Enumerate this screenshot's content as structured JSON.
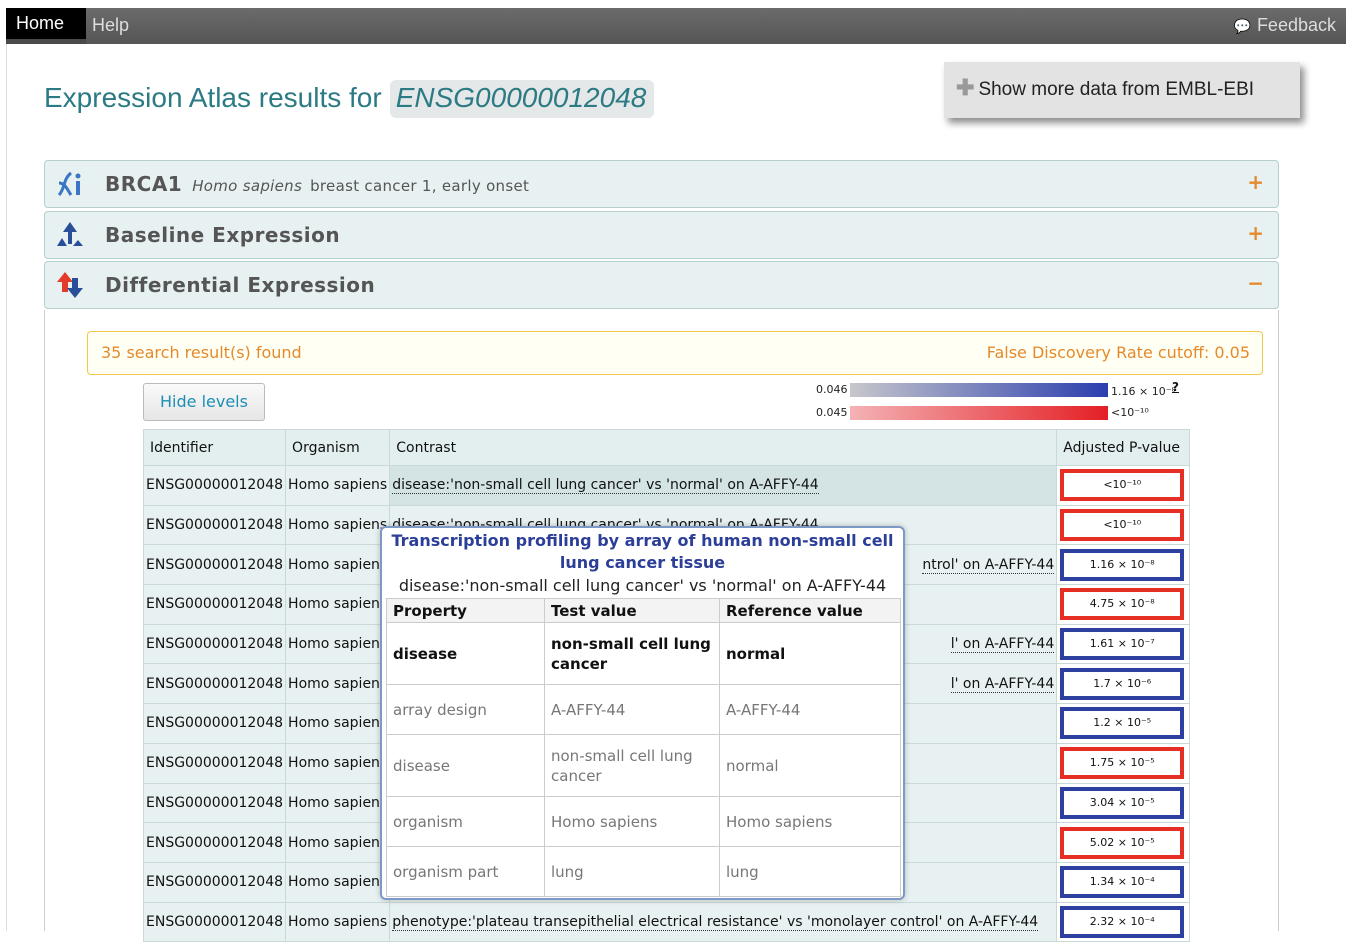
{
  "nav": {
    "home": "Home",
    "help": "Help",
    "feedback": "Feedback"
  },
  "page": {
    "title_prefix": "Expression Atlas results for",
    "gene_id": "ENSG00000012048",
    "more_data": "Show more data from EMBL-EBI"
  },
  "panels": {
    "gene": {
      "symbol": "BRCA1",
      "species": "Homo sapiens",
      "description": "breast cancer 1, early onset",
      "toggle": "+"
    },
    "baseline": {
      "title": "Baseline Expression",
      "toggle": "+"
    },
    "differential": {
      "title": "Differential Expression",
      "toggle": "−"
    }
  },
  "results": {
    "found": "35 search result(s) found",
    "fdr": "False Discovery Rate cutoff: 0.05",
    "hide_levels": "Hide levels"
  },
  "legend": {
    "blue_min": "0.046",
    "blue_max": "1.16 × 10⁻⁸",
    "red_min": "0.045",
    "red_max": "<10⁻¹⁰",
    "help": "?"
  },
  "table": {
    "headers": [
      "Identifier",
      "Organism",
      "Contrast",
      "Adjusted P-value"
    ],
    "rows": [
      {
        "id": "ENSG00000012048",
        "organism": "Homo sapiens",
        "contrast": "disease:'non-small cell lung cancer' vs 'normal' on A-AFFY-44",
        "pvalue": "<10⁻¹⁰",
        "color": "red"
      },
      {
        "id": "ENSG00000012048",
        "organism": "Homo sapiens",
        "contrast": "disease:'non-small cell lung cancer' vs 'normal' on A-AFFY-44",
        "pvalue": "<10⁻¹⁰",
        "color": "red"
      },
      {
        "id": "ENSG00000012048",
        "organism": "Homo sapiens",
        "contrast": "ntrol' on A-AFFY-44",
        "pvalue": "1.16 × 10⁻⁸",
        "color": "blue"
      },
      {
        "id": "ENSG00000012048",
        "organism": "Homo sapiens",
        "contrast": "",
        "pvalue": "4.75 × 10⁻⁸",
        "color": "red"
      },
      {
        "id": "ENSG00000012048",
        "organism": "Homo sapiens",
        "contrast": "l' on A-AFFY-44",
        "pvalue": "1.61 × 10⁻⁷",
        "color": "blue"
      },
      {
        "id": "ENSG00000012048",
        "organism": "Homo sapiens",
        "contrast": "l' on A-AFFY-44",
        "pvalue": "1.7 × 10⁻⁶",
        "color": "blue"
      },
      {
        "id": "ENSG00000012048",
        "organism": "Homo sapiens",
        "contrast": "",
        "pvalue": "1.2 × 10⁻⁵",
        "color": "blue"
      },
      {
        "id": "ENSG00000012048",
        "organism": "Homo sapiens",
        "contrast": "",
        "pvalue": "1.75 × 10⁻⁵",
        "color": "red"
      },
      {
        "id": "ENSG00000012048",
        "organism": "Homo sapiens",
        "contrast": "",
        "pvalue": "3.04 × 10⁻⁵",
        "color": "blue"
      },
      {
        "id": "ENSG00000012048",
        "organism": "Homo sapiens",
        "contrast": "",
        "pvalue": "5.02 × 10⁻⁵",
        "color": "red"
      },
      {
        "id": "ENSG00000012048",
        "organism": "Homo sapiens",
        "contrast": "",
        "pvalue": "1.34 × 10⁻⁴",
        "color": "blue"
      },
      {
        "id": "ENSG00000012048",
        "organism": "Homo sapiens",
        "contrast": "phenotype:'plateau transepithelial electrical resistance' vs 'monolayer control' on A-AFFY-44",
        "pvalue": "2.32 × 10⁻⁴",
        "color": "blue"
      }
    ]
  },
  "tooltip": {
    "title": "Transcription profiling by array of human non-small cell lung cancer tissue",
    "subtitle": "disease:'non-small cell lung cancer' vs 'normal' on A-AFFY-44",
    "headers": [
      "Property",
      "Test value",
      "Reference value"
    ],
    "rows": [
      {
        "property": "disease",
        "test": "non-small cell lung cancer",
        "reference": "normal"
      },
      {
        "property": "array design",
        "test": "A-AFFY-44",
        "reference": "A-AFFY-44"
      },
      {
        "property": "disease",
        "test": "non-small cell lung cancer",
        "reference": "normal"
      },
      {
        "property": "organism",
        "test": "Homo sapiens",
        "reference": "Homo sapiens"
      },
      {
        "property": "organism part",
        "test": "lung",
        "reference": "lung"
      }
    ]
  },
  "colors": {
    "accent_teal": "#2b7a84",
    "orange": "#e58a2c",
    "pval_red": "#e62f24",
    "pval_blue": "#2d3f9f",
    "tooltip_title": "#2c3f98"
  }
}
